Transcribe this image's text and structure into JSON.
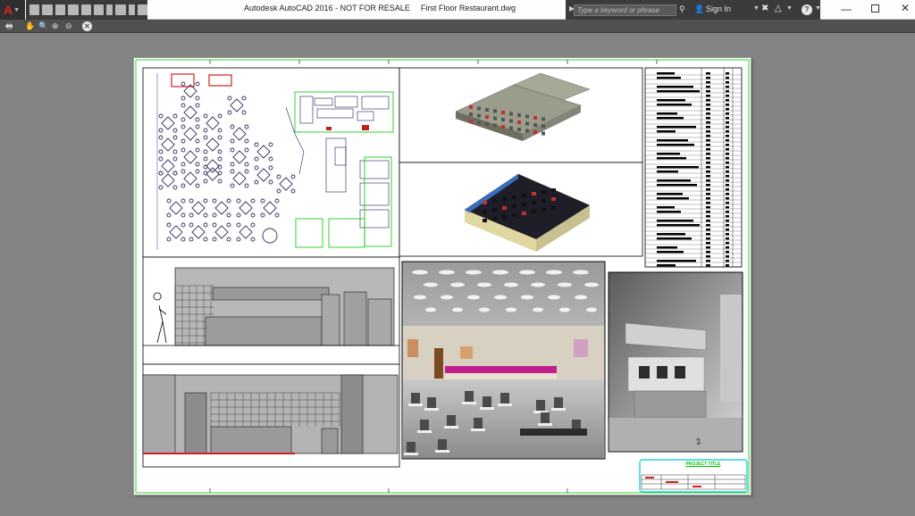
{
  "app": {
    "menu_label": "A"
  },
  "window": {
    "app_name": "Autodesk AutoCAD 2016 - NOT FOR RESALE",
    "document": "First Floor Restaurant.dwg"
  },
  "search": {
    "placeholder": "Type a keyword or phrase"
  },
  "account": {
    "signin_label": "Sign In"
  },
  "help": {
    "label": "?"
  },
  "drawing": {
    "stamp_title": "PROJECT TITLE",
    "view_marker": "2"
  },
  "colors": {
    "ui_dark": "#3b3b3b",
    "canvas": "#838383",
    "sheet_border": "#00c800",
    "title_stamp": "#00c8dc",
    "accent_magenta": "#c0208c",
    "furniture_red": "#d02020"
  },
  "icons": [
    "app-menu-icon",
    "new-icon",
    "open-icon",
    "save-icon",
    "save-as-icon",
    "print-icon",
    "undo-icon",
    "redo-icon",
    "workspace-icon",
    "binoculars-icon",
    "user-icon",
    "exchange-icon",
    "a360-icon",
    "help-icon",
    "pan-icon",
    "zoom-icon",
    "zoom-window-icon",
    "zoom-previous-icon",
    "close-preview-icon"
  ]
}
